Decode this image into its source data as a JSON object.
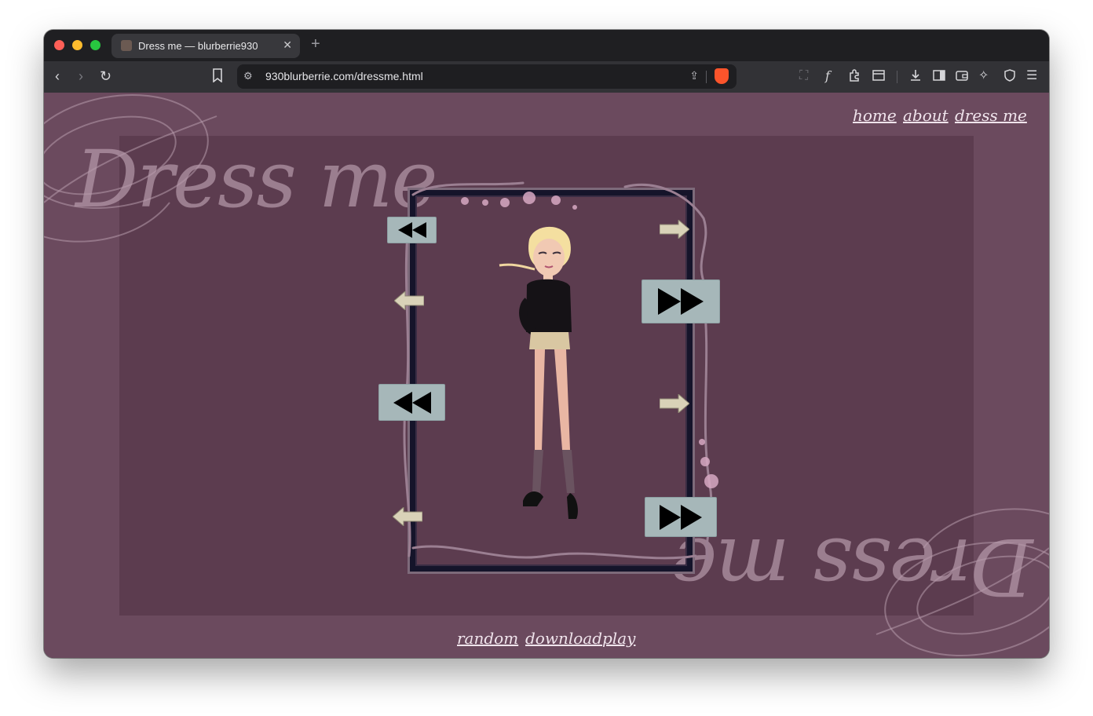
{
  "browser": {
    "tab_title": "Dress me — blurberrie930",
    "url": "930blurberrie.com/dressme.html"
  },
  "page": {
    "heading": "Dress me",
    "heading_mirror": "Dress me",
    "nav": [
      {
        "label": "home"
      },
      {
        "label": "about"
      },
      {
        "label": "dress me"
      }
    ],
    "footer": [
      {
        "label": "random"
      },
      {
        "label": "download"
      },
      {
        "label": "play"
      }
    ]
  },
  "colors": {
    "page_bg": "#6b4a5e",
    "panel_bg": "#5c3c4f",
    "button_bg": "#a6b7b9",
    "frame": "#15142a"
  },
  "icons": {
    "back": "chevron-left-icon",
    "forward": "chevron-right-icon",
    "reload": "reload-icon",
    "bookmark": "bookmark-icon",
    "site_settings": "site-settings-icon",
    "share": "share-icon",
    "brave_shield": "brave-shield-icon",
    "extensions": "puzzle-icon",
    "downloads": "download-icon",
    "sidebar": "sidebar-icon",
    "wallet": "wallet-icon",
    "leo": "sparkle-icon",
    "vpn": "shield-icon",
    "menu": "hamburger-icon"
  }
}
